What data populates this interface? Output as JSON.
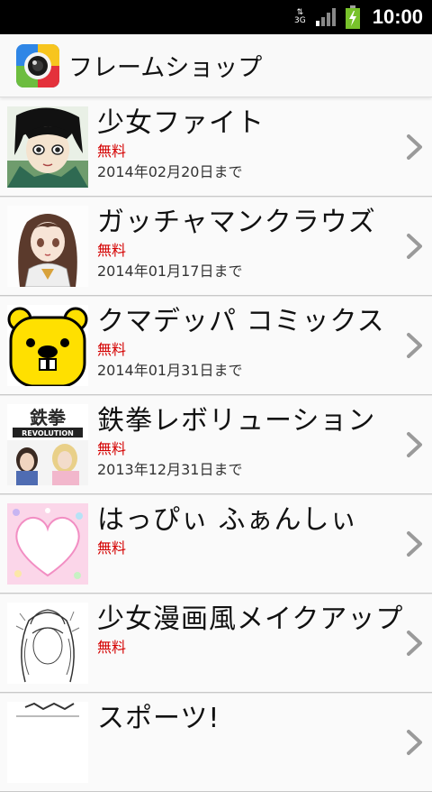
{
  "status_bar": {
    "network": "3G",
    "time": "10:00"
  },
  "header": {
    "title": "フレームショップ",
    "icon": "camera-lens-icon"
  },
  "items": [
    {
      "name": "少女ファイト",
      "price": "無料",
      "until": "2014年02月20日まで",
      "thumb": "manga-girl-thumbnail"
    },
    {
      "name": "ガッチャマンクラウズ",
      "price": "無料",
      "until": "2014年01月17日まで",
      "thumb": "anime-girl-thumbnail"
    },
    {
      "name": "クマデッパ コミックス",
      "price": "無料",
      "until": "2014年01月31日まで",
      "thumb": "yellow-bear-thumbnail"
    },
    {
      "name": "鉄拳レボリューション",
      "price": "無料",
      "until": "2013年12月31日まで",
      "thumb": "tekken-revolution-thumbnail",
      "thumb_text": "鉄拳 REVOLUTION"
    },
    {
      "name": "はっぴぃ ふぁんしぃ",
      "price": "無料",
      "until": "",
      "thumb": "pink-heart-frame-thumbnail"
    },
    {
      "name": "少女漫画風メイクアップ",
      "price": "無料",
      "until": "",
      "thumb": "manga-sketch-thumbnail"
    },
    {
      "name": "スポーツ!",
      "price": "",
      "until": "",
      "thumb": "partial-thumbnail"
    }
  ]
}
